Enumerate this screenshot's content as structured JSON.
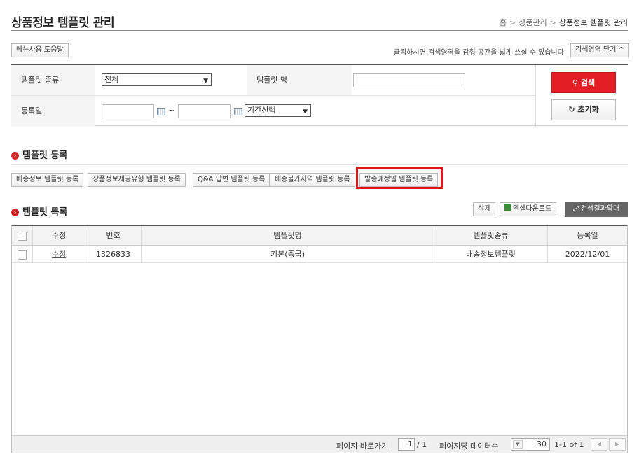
{
  "header": {
    "title": "상품정보 템플릿 관리",
    "breadcrumb": [
      "홈",
      "상품관리",
      "상품정보 템플릿 관리"
    ],
    "breadcrumb_sep": ">"
  },
  "toolbar": {
    "help_label": "메뉴사용 도움말",
    "toggle_hint": "클릭하시면 검색영역을 감춰 공간을 넓게 쓰실 수 있습니다.",
    "toggle_label": "검색영역 닫기"
  },
  "search": {
    "template_type_label": "템플릿 종류",
    "template_type_value": "전체",
    "template_name_label": "템플릿 명",
    "template_name_value": "",
    "reg_date_label": "등록일",
    "date_from": "",
    "date_to": "",
    "range_tilde": "~",
    "period_value": "기간선택",
    "search_button": "검색",
    "reset_button": "초기화"
  },
  "registration": {
    "title": "템플릿 등록",
    "buttons": [
      "배송정보 템플릿 등록",
      "상품정보제공유형 템플릿 등록",
      "Q&A 답변 템플릿 등록",
      "배송불가지역 템플릿 등록",
      "발송예정일 템플릿 등록"
    ]
  },
  "list": {
    "title": "템플릿 목록",
    "delete_button": "삭제",
    "excel_button": "엑셀다운로드",
    "expand_button": "검색결과확대",
    "columns": [
      "수정",
      "번호",
      "템플릿명",
      "템플릿종류",
      "등록일"
    ],
    "rows": [
      {
        "edit": "수정",
        "no": "1326833",
        "name": "기본(중국)",
        "type": "배송정보템플릿",
        "date": "2022/12/01"
      }
    ]
  },
  "pagination": {
    "goto_label": "페이지 바로가기",
    "current_page": "1",
    "total_pages": "/ 1",
    "per_page_label": "페이지당 데이터수",
    "per_page_value": "30",
    "range": "1-1 of 1"
  },
  "colors": {
    "accent": "#e31e24",
    "highlight": "#e3141b"
  }
}
